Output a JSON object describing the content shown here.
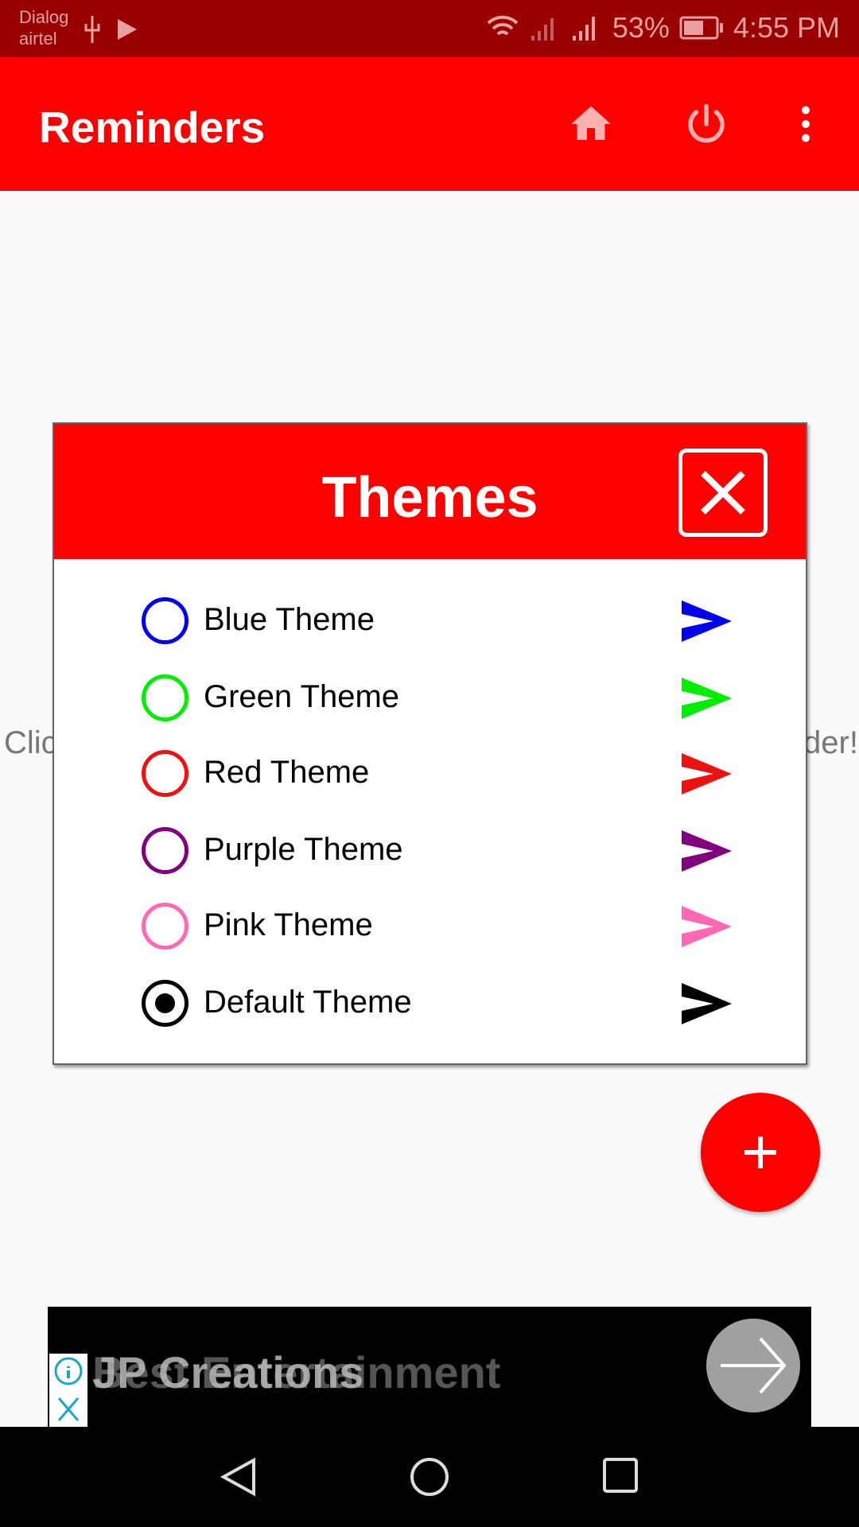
{
  "status_bar": {
    "carrier_line1": "Dialog",
    "carrier_line2": "airtel",
    "battery": "53%",
    "time": "4:55 PM"
  },
  "app_bar": {
    "title": "Reminders",
    "icons": [
      "home-icon",
      "power-icon",
      "more-vert-icon"
    ]
  },
  "background_text": {
    "left_fragment": "Clic",
    "right_fragment": "der!"
  },
  "dialog": {
    "title": "Themes",
    "options": [
      {
        "label": "Blue Theme",
        "color": "#0000ee",
        "selected": false
      },
      {
        "label": "Green Theme",
        "color": "#00ee00",
        "selected": false
      },
      {
        "label": "Red Theme",
        "color": "#ee1111",
        "selected": false
      },
      {
        "label": "Purple Theme",
        "color": "#800080",
        "selected": false
      },
      {
        "label": "Pink Theme",
        "color": "#ff69b4",
        "selected": false
      },
      {
        "label": "Default Theme",
        "color": "#000000",
        "selected": true
      }
    ]
  },
  "fab": {
    "icon": "plus-icon"
  },
  "ad": {
    "text_back": "Best Entertainment",
    "text_front": "JP Creations"
  },
  "colors": {
    "primary": "#ff0000",
    "status": "#990000",
    "background": "#fafafa"
  }
}
